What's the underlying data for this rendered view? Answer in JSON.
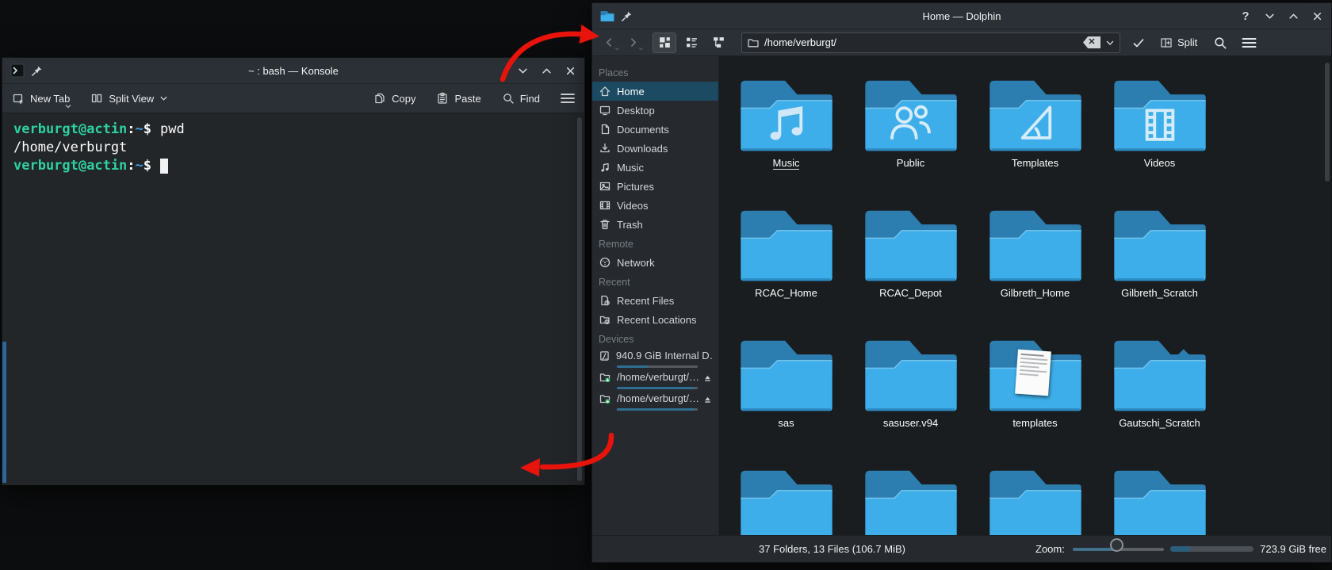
{
  "colors": {
    "accent": "#3daee9",
    "selection": "#1d4a63",
    "folder_body": "#3daee9",
    "folder_tab": "#2c7db0",
    "arrow": "#e8140c",
    "terminal_green": "#2dd2a2",
    "terminal_blue": "#3f9be0",
    "terminal_bg": "#232629"
  },
  "konsole": {
    "title": "~ : bash — Konsole",
    "toolbar": {
      "new_tab": "New Tab",
      "split_view": "Split View",
      "copy": "Copy",
      "paste": "Paste",
      "find": "Find"
    },
    "terminal": {
      "prompt_user": "verburgt@actin",
      "prompt_sep": ":",
      "prompt_path": "~",
      "prompt_sign": "$",
      "command": "pwd",
      "output": "/home/verburgt"
    }
  },
  "dolphin": {
    "title": "Home — Dolphin",
    "location": "/home/verburgt/",
    "toolbar": {
      "split_label": "Split"
    },
    "sidebar": {
      "sections": [
        {
          "header": "Places",
          "items": [
            {
              "icon": "home-icon",
              "label": "Home",
              "selected": true
            },
            {
              "icon": "desktop-icon",
              "label": "Desktop"
            },
            {
              "icon": "documents-icon",
              "label": "Documents"
            },
            {
              "icon": "downloads-icon",
              "label": "Downloads"
            },
            {
              "icon": "music-icon",
              "label": "Music"
            },
            {
              "icon": "pictures-icon",
              "label": "Pictures"
            },
            {
              "icon": "videos-icon",
              "label": "Videos"
            },
            {
              "icon": "trash-icon",
              "label": "Trash"
            }
          ]
        },
        {
          "header": "Remote",
          "items": [
            {
              "icon": "network-icon",
              "label": "Network"
            }
          ]
        },
        {
          "header": "Recent",
          "items": [
            {
              "icon": "recent-files-icon",
              "label": "Recent Files"
            },
            {
              "icon": "recent-locations-icon",
              "label": "Recent Locations"
            }
          ]
        },
        {
          "header": "Devices",
          "items": [
            {
              "icon": "harddisk-icon",
              "label": "940.9 GiB Internal D…",
              "usage": 0.38
            },
            {
              "icon": "folder-mounted-icon",
              "label": "/home/verburgt/…",
              "usage": 0.96,
              "eject": true
            },
            {
              "icon": "folder-mounted-icon",
              "label": "/home/verburgt/…",
              "usage": 0.96,
              "eject": true
            }
          ]
        }
      ]
    },
    "grid": {
      "rows": [
        [
          {
            "label": "Music",
            "emblem": "music",
            "focused": true
          },
          {
            "label": "Public",
            "emblem": "people"
          },
          {
            "label": "Templates",
            "emblem": "triangle"
          },
          {
            "label": "Videos",
            "emblem": "film"
          }
        ],
        [
          {
            "label": "RCAC_Home"
          },
          {
            "label": "RCAC_Depot"
          },
          {
            "label": "Gilbreth_Home"
          },
          {
            "label": "Gilbreth_Scratch"
          }
        ],
        [
          {
            "label": "sas"
          },
          {
            "label": "sasuser.v94"
          },
          {
            "label": "templates",
            "emblem": "paper"
          },
          {
            "label": "Gautschi_Scratch",
            "variant": "flap"
          }
        ],
        [
          {
            "label": ""
          },
          {
            "label": ""
          },
          {
            "label": ""
          },
          {
            "label": ""
          }
        ]
      ]
    },
    "statusbar": {
      "summary": "37 Folders, 13 Files (106.7 MiB)",
      "zoom_label": "Zoom:",
      "free_space": "723.9 GiB free"
    }
  }
}
